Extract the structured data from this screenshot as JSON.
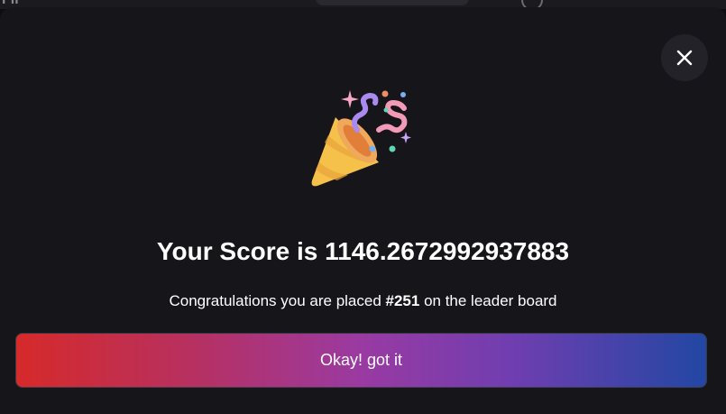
{
  "background": {
    "partial_text": "Fil"
  },
  "dialog": {
    "close_icon": "close-icon",
    "illustration_icon": "party-popper-icon",
    "score_text": "Your Score is 1146.2672992937883",
    "message_prefix": "Congratulations you are placed ",
    "rank": "#251",
    "message_suffix": " on the leader board",
    "ok_button_label": "Okay! got it"
  },
  "colors": {
    "modal_background": "#16151a",
    "close_button_background": "#232228",
    "button_gradient": [
      "#d62a2a",
      "#b7305f",
      "#9a3aa2",
      "#6f3eb0",
      "#2247a3"
    ]
  }
}
